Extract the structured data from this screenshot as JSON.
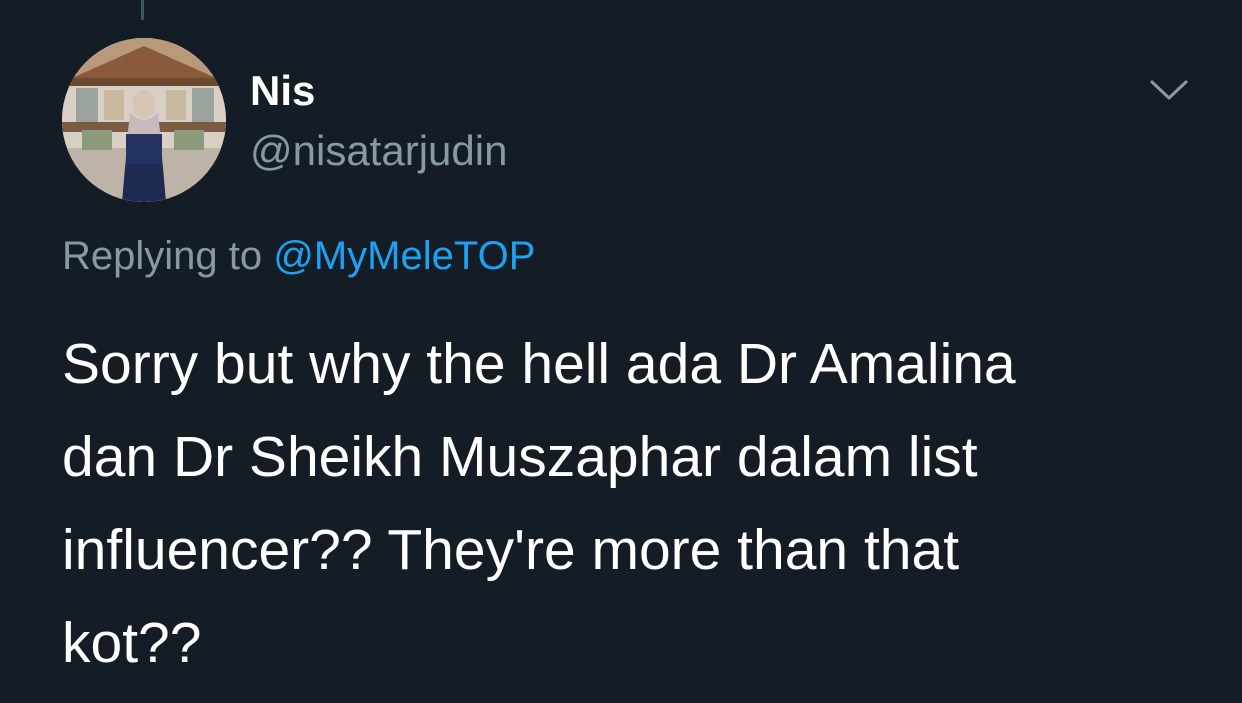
{
  "author": {
    "display_name": "Nis",
    "username": "@nisatarjudin"
  },
  "reply": {
    "prefix": "Replying to",
    "handle": "@MyMeleTOP"
  },
  "tweet": {
    "lines": [
      "Sorry but why the hell ada Dr Amalina",
      "dan Dr Sheikh Muszaphar dalam list",
      "influencer?? They're more than that",
      "kot??"
    ]
  },
  "icons": {
    "caret": "chevron-down-icon",
    "avatar": "profile-photo"
  },
  "colors": {
    "background": "#141d26",
    "text": "#ffffff",
    "secondary": "#8899a6",
    "link": "#1da1f2"
  }
}
